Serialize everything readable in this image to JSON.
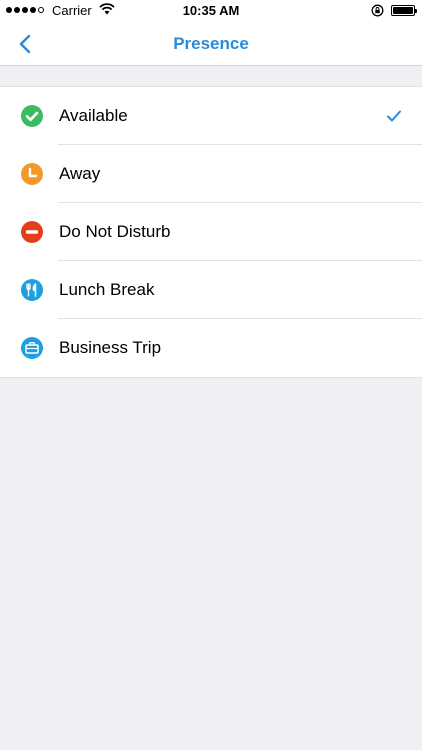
{
  "status_bar": {
    "carrier": "Carrier",
    "time": "10:35 AM"
  },
  "nav": {
    "title": "Presence"
  },
  "colors": {
    "accent": "#2d8ad6",
    "available": "#3dbb63",
    "away": "#f2992e",
    "dnd": "#e2401c",
    "lunch": "#1ea0e0",
    "business": "#1ea0e0"
  },
  "presence": {
    "selected": "Available",
    "items": [
      {
        "label": "Available",
        "icon": "check-circle-icon"
      },
      {
        "label": "Away",
        "icon": "clock-icon"
      },
      {
        "label": "Do Not Disturb",
        "icon": "minus-circle-icon"
      },
      {
        "label": "Lunch Break",
        "icon": "fork-knife-icon"
      },
      {
        "label": "Business Trip",
        "icon": "briefcase-icon"
      }
    ]
  }
}
